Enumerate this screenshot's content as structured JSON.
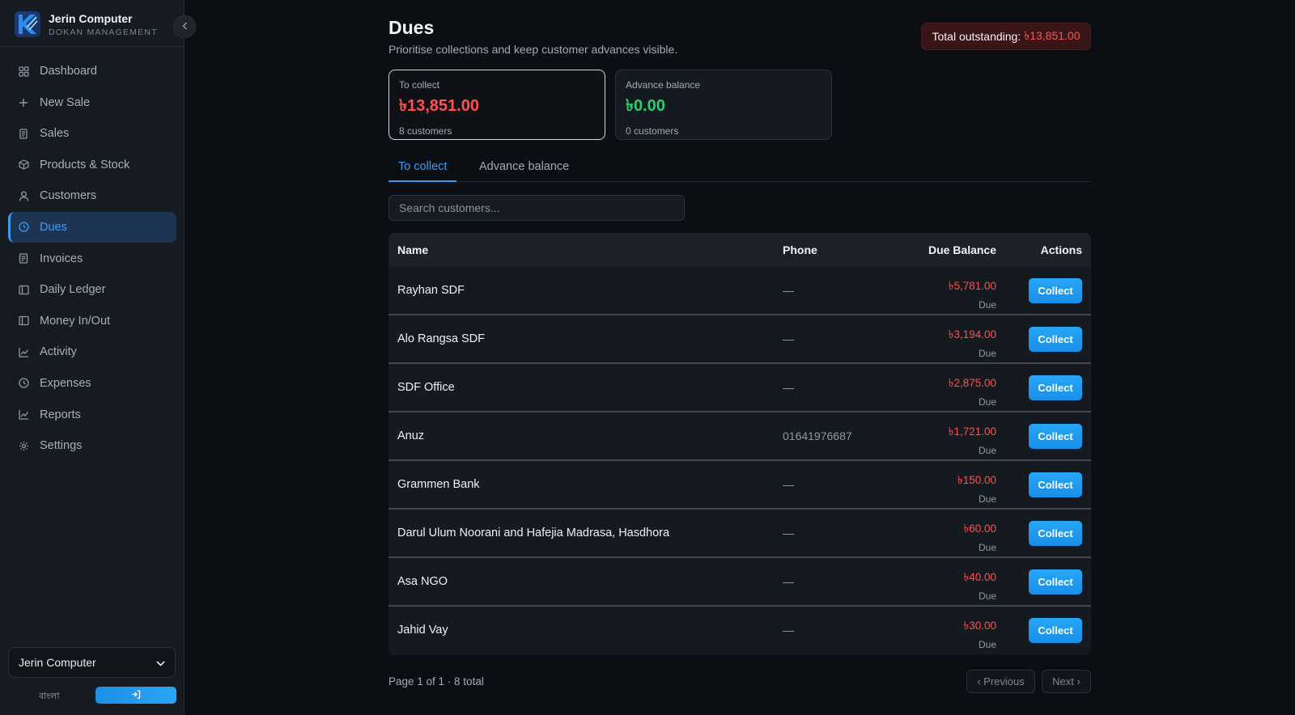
{
  "brand": {
    "name": "Jerin Computer",
    "subtitle": "DOKAN MANAGEMENT"
  },
  "sidebar": {
    "items": [
      {
        "label": "Dashboard",
        "icon": "grid-icon"
      },
      {
        "label": "New Sale",
        "icon": "plus-icon"
      },
      {
        "label": "Sales",
        "icon": "receipt-icon"
      },
      {
        "label": "Products & Stock",
        "icon": "box-icon"
      },
      {
        "label": "Customers",
        "icon": "user-icon"
      },
      {
        "label": "Dues",
        "icon": "clock-icon",
        "active": true
      },
      {
        "label": "Invoices",
        "icon": "document-icon"
      },
      {
        "label": "Daily Ledger",
        "icon": "book-icon"
      },
      {
        "label": "Money In/Out",
        "icon": "book-icon"
      },
      {
        "label": "Activity",
        "icon": "chart-icon"
      },
      {
        "label": "Expenses",
        "icon": "clock-icon"
      },
      {
        "label": "Reports",
        "icon": "chart-icon"
      },
      {
        "label": "Settings",
        "icon": "gear-icon"
      }
    ],
    "shop_selector": "Jerin Computer",
    "language": "বাংলা"
  },
  "page": {
    "title": "Dues",
    "subtitle": "Prioritise collections and keep customer advances visible.",
    "outstanding_label": "Total outstanding:",
    "outstanding_amount": "৳13,851.00"
  },
  "cards": {
    "collect": {
      "label": "To collect",
      "amount": "৳13,851.00",
      "count": "8 customers"
    },
    "advance": {
      "label": "Advance balance",
      "amount": "৳0.00",
      "count": "0 customers"
    }
  },
  "tabs": {
    "collect": "To collect",
    "advance": "Advance balance"
  },
  "search": {
    "placeholder": "Search customers..."
  },
  "table": {
    "headers": {
      "name": "Name",
      "phone": "Phone",
      "due": "Due Balance",
      "actions": "Actions"
    },
    "action_label": "Collect",
    "rows": [
      {
        "name": "Rayhan SDF",
        "phone": "—",
        "due": "৳5,781.00",
        "status": "Due"
      },
      {
        "name": "Alo Rangsa SDF",
        "phone": "—",
        "due": "৳3,194.00",
        "status": "Due"
      },
      {
        "name": "SDF Office",
        "phone": "—",
        "due": "৳2,875.00",
        "status": "Due"
      },
      {
        "name": "Anuz",
        "phone": "01641976687",
        "due": "৳1,721.00",
        "status": "Due"
      },
      {
        "name": "Grammen Bank",
        "phone": "—",
        "due": "৳150.00",
        "status": "Due"
      },
      {
        "name": "Darul Ulum Noorani and Hafejia Madrasa, Hasdhora",
        "phone": "—",
        "due": "৳60.00",
        "status": "Due"
      },
      {
        "name": "Asa NGO",
        "phone": "—",
        "due": "৳40.00",
        "status": "Due"
      },
      {
        "name": "Jahid Vay",
        "phone": "—",
        "due": "৳30.00",
        "status": "Due"
      }
    ]
  },
  "pagination": {
    "info": "Page 1 of 1 · 8 total",
    "previous": "‹ Previous",
    "next": "Next ›"
  },
  "colors": {
    "accent": "#3b9cf5",
    "danger": "#ff4f4f",
    "success": "#2ecc71",
    "background": "#0b0e13",
    "sidebar": "#161a21"
  }
}
